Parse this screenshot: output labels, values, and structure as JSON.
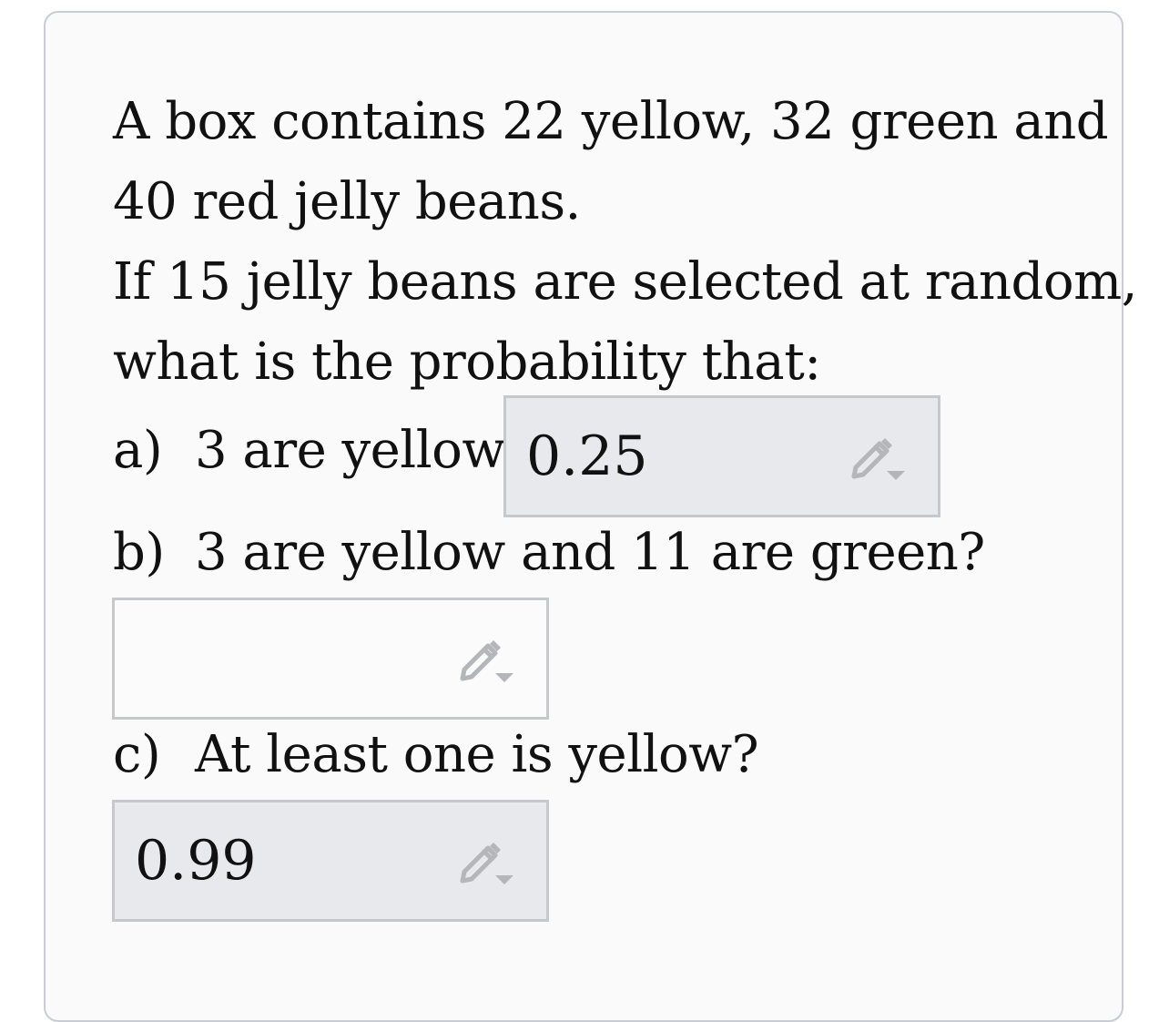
{
  "problem": {
    "lines": [
      "A box contains 22 yellow, 32 green and",
      "40 red jelly beans.",
      "If 15 jelly beans are selected at random,",
      "what is the probability that:"
    ]
  },
  "questions": [
    {
      "label": "a)",
      "text": "3 are yellow?",
      "answer": "0.25",
      "placeholder": ""
    },
    {
      "label": "b)",
      "text": "3 are yellow and 11 are green?",
      "answer": "",
      "placeholder": ""
    },
    {
      "label": "c)",
      "text": "At least one is yellow?",
      "answer": "0.99",
      "placeholder": ""
    }
  ],
  "icons": {
    "edit": "pencil-dropdown-icon"
  },
  "colors": {
    "filled_box": "#e8e9ec",
    "box_border": "#c6c8cc",
    "icon": "#b4b6ba"
  }
}
